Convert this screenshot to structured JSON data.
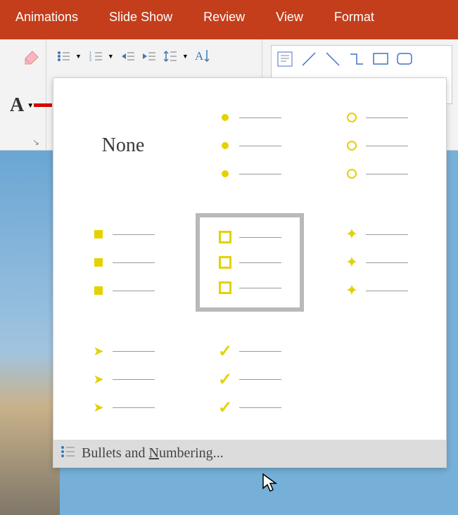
{
  "tabs": {
    "animations": "Animations",
    "slideshow": "Slide Show",
    "review": "Review",
    "view": "View",
    "format": "Format"
  },
  "dropdown": {
    "none": "None",
    "footer": {
      "prefix": "Bullets and ",
      "ul": "N",
      "rest": "umbering..."
    }
  }
}
